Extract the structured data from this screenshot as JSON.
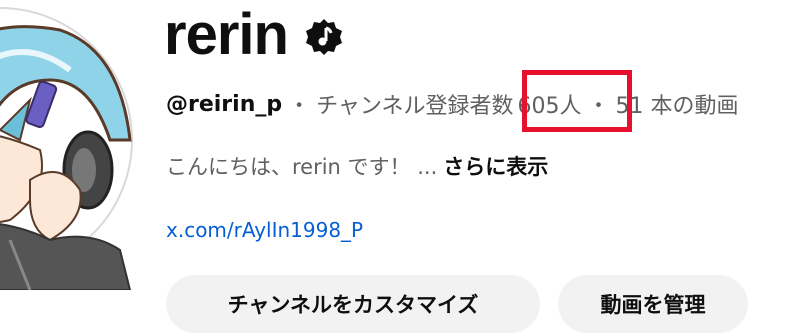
{
  "channel": {
    "name": "rerin",
    "handle": "@reirin_p",
    "separator": "・",
    "subscribers_label": "チャンネル登録者数",
    "subscribers_count": "605人",
    "video_count": "51 本の動画",
    "description": "こんにちは、rerin です！ ...",
    "more_label": "さらに表示",
    "link": "x.com/rAylIn1998_P"
  },
  "buttons": {
    "customize": "チャンネルをカスタマイズ",
    "manage": "動画を管理"
  },
  "colors": {
    "highlight": "#e8112d",
    "link": "#065fd4",
    "muted": "#606060",
    "button_bg": "#f2f2f2"
  },
  "icons": {
    "verified": "music-note-badge-icon"
  }
}
